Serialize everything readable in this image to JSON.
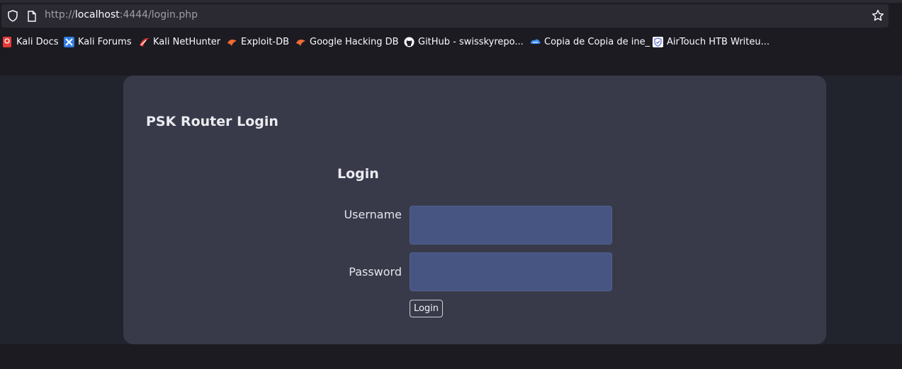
{
  "browser": {
    "url_scheme": "http://",
    "url_host": "localhost",
    "url_rest": ":4444/login.php",
    "icons": [
      "shield-icon",
      "page-icon",
      "star-icon"
    ]
  },
  "bookmarks": [
    {
      "label": "Kali Docs",
      "icon": "kali-docs-icon",
      "color": "#e53935"
    },
    {
      "label": "Kali Forums",
      "icon": "kali-forums-icon",
      "color": "#2f7de1"
    },
    {
      "label": "Kali NetHunter",
      "icon": "kali-nethunter-icon",
      "color": "#e53935"
    },
    {
      "label": "Exploit-DB",
      "icon": "exploit-db-icon",
      "color": "#ef6c35"
    },
    {
      "label": "Google Hacking DB",
      "icon": "google-hacking-db-icon",
      "color": "#ef6c35"
    },
    {
      "label": "GitHub - swisskyrepo...",
      "icon": "github-icon",
      "color": "#fbfbfe"
    },
    {
      "label": "Copia de Copia de ine_",
      "icon": "cloud-icon",
      "color": "#3f8ef5"
    },
    {
      "label": "AirTouch HTB Writeu...",
      "icon": "shield-check-icon",
      "color": "#5a6fd6"
    }
  ],
  "page": {
    "card_title": "PSK Router Login",
    "form_title": "Login",
    "username_label": "Username",
    "username_value": "",
    "password_label": "Password",
    "password_value": "",
    "login_button": "Login"
  },
  "colors": {
    "background": "#1c1b22",
    "card": "#383a4a",
    "input": "#475582"
  }
}
